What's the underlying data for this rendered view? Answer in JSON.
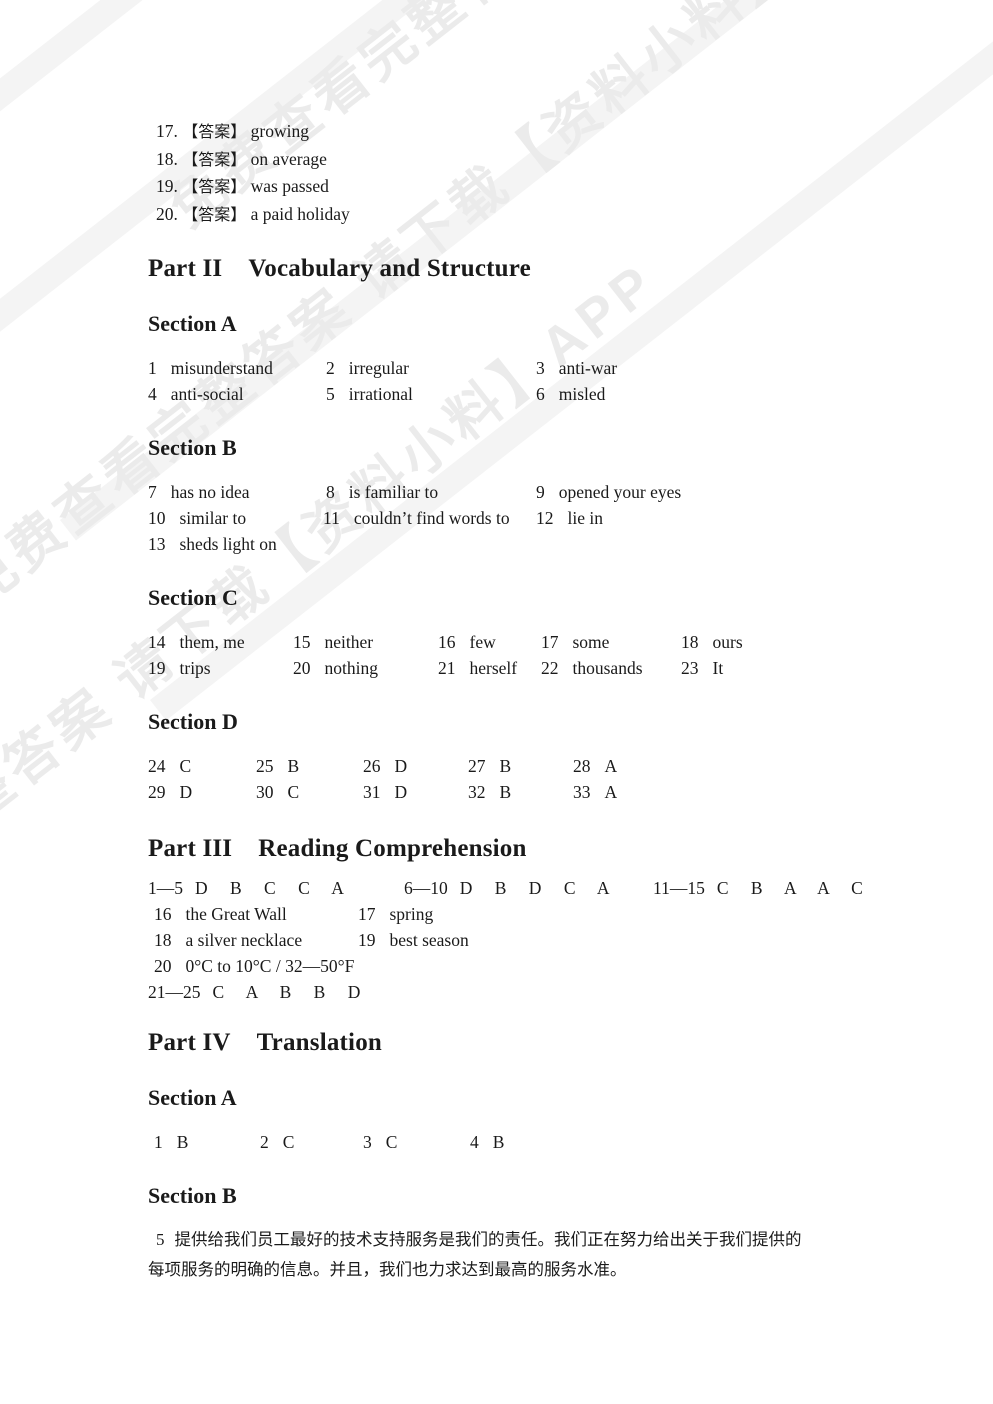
{
  "page": {
    "background": "#ffffff",
    "text_color": "#1a1a1a"
  },
  "watermark": {
    "text": "免费查看完整答案 请下载【资料小料】APP",
    "color": "#ebebeb"
  },
  "answer_key": {
    "items": [
      {
        "num": "17.",
        "tag": "【答案】",
        "value": "growing"
      },
      {
        "num": "18.",
        "tag": "【答案】",
        "value": "on average"
      },
      {
        "num": "19.",
        "tag": "【答案】",
        "value": "was passed"
      },
      {
        "num": "20.",
        "tag": "【答案】",
        "value": "a paid holiday"
      }
    ]
  },
  "part2": {
    "label": "Part II",
    "title": "Vocabulary and Structure",
    "sectionA": {
      "heading": "Section A",
      "rows": [
        [
          {
            "n": "1",
            "v": "misunderstand"
          },
          {
            "n": "2",
            "v": "irregular"
          },
          {
            "n": "3",
            "v": "anti-war"
          }
        ],
        [
          {
            "n": "4",
            "v": "anti-social"
          },
          {
            "n": "5",
            "v": "irrational"
          },
          {
            "n": "6",
            "v": "misled"
          }
        ]
      ]
    },
    "sectionB": {
      "heading": "Section B",
      "rows": [
        [
          {
            "n": "7",
            "v": "has no idea"
          },
          {
            "n": "8",
            "v": "is familiar to"
          },
          {
            "n": "9",
            "v": "opened your eyes"
          }
        ],
        [
          {
            "n": "10",
            "v": "similar to"
          },
          {
            "n": "11",
            "v": "couldn’t find words to"
          },
          {
            "n": "12",
            "v": "lie in"
          }
        ],
        [
          {
            "n": "13",
            "v": "sheds light on"
          }
        ]
      ]
    },
    "sectionC": {
      "heading": "Section C",
      "rows": [
        [
          {
            "n": "14",
            "v": "them, me"
          },
          {
            "n": "15",
            "v": "neither"
          },
          {
            "n": "16",
            "v": "few"
          },
          {
            "n": "17",
            "v": "some"
          },
          {
            "n": "18",
            "v": "ours"
          }
        ],
        [
          {
            "n": "19",
            "v": "trips"
          },
          {
            "n": "20",
            "v": "nothing"
          },
          {
            "n": "21",
            "v": "herself"
          },
          {
            "n": "22",
            "v": "thousands"
          },
          {
            "n": "23",
            "v": "It"
          }
        ]
      ]
    },
    "sectionD": {
      "heading": "Section D",
      "rows": [
        [
          {
            "n": "24",
            "v": "C"
          },
          {
            "n": "25",
            "v": "B"
          },
          {
            "n": "26",
            "v": "D"
          },
          {
            "n": "27",
            "v": "B"
          },
          {
            "n": "28",
            "v": "A"
          }
        ],
        [
          {
            "n": "29",
            "v": "D"
          },
          {
            "n": "30",
            "v": "C"
          },
          {
            "n": "31",
            "v": "D"
          },
          {
            "n": "32",
            "v": "B"
          },
          {
            "n": "33",
            "v": "A"
          }
        ]
      ]
    }
  },
  "part3": {
    "label": "Part III",
    "title": "Reading Comprehension",
    "ranges_row": [
      {
        "lbl": "1—5",
        "letters": "D B C C A"
      },
      {
        "lbl": "6—10",
        "letters": "D B D C A"
      },
      {
        "lbl": "11—15",
        "letters": "C B A A C"
      }
    ],
    "rows": [
      [
        {
          "n": "16",
          "v": "the Great Wall"
        },
        {
          "n": "17",
          "v": "spring"
        }
      ],
      [
        {
          "n": "18",
          "v": "a silver necklace"
        },
        {
          "n": "19",
          "v": "best season"
        }
      ],
      [
        {
          "n": "20",
          "v": "0°C to 10°C / 32—50°F"
        }
      ]
    ],
    "final_range": {
      "lbl": "21—25",
      "letters": "C A B B D"
    }
  },
  "part4": {
    "label": "Part IV",
    "title": "Translation",
    "sectionA": {
      "heading": "Section A",
      "rows": [
        [
          {
            "n": "1",
            "v": "B"
          },
          {
            "n": "2",
            "v": "C"
          },
          {
            "n": "3",
            "v": "C"
          },
          {
            "n": "4",
            "v": "B"
          }
        ]
      ]
    },
    "sectionB": {
      "heading": "Section B",
      "item_num": "5",
      "line1": "提供给我们员工最好的技术支持服务是我们的责任。我们正在努力给出关于我们提供的",
      "line2": "每项服务的明确的信息。并且，我们也力求达到最高的服务水准。"
    }
  }
}
